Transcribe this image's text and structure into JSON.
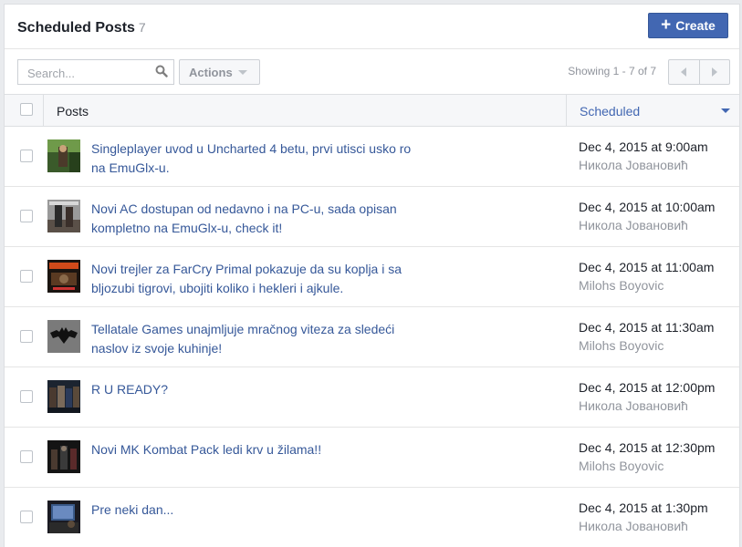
{
  "header": {
    "title": "Scheduled Posts",
    "count": "7",
    "create_label": "Create"
  },
  "toolbar": {
    "search_placeholder": "Search...",
    "actions_label": "Actions",
    "showing_text": "Showing 1 - 7 of 7"
  },
  "table": {
    "col_posts": "Posts",
    "col_scheduled": "Scheduled",
    "rows": [
      {
        "text": "Singleplayer uvod u Uncharted 4 betu, prvi utisci usko ro na EmuGlx-u.",
        "time": "Dec 4, 2015 at 9:00am",
        "author": "Никола Јовановић"
      },
      {
        "text": "Novi AC dostupan od nedavno i na PC-u, sada opisan kompletno na EmuGlx-u, check it!",
        "time": "Dec 4, 2015 at 10:00am",
        "author": "Никола Јовановић"
      },
      {
        "text": "Novi trejler za FarCry Primal pokazuje da su koplja i sa bljozubi tigrovi, ubojiti koliko i hekleri i ajkule.",
        "time": "Dec 4, 2015 at 11:00am",
        "author": "Milohs Boyovic"
      },
      {
        "text": "Tellatale Games unajmljuje mračnog viteza za sledeći naslov iz svoje kuhinje!",
        "time": "Dec 4, 2015 at 11:30am",
        "author": "Milohs Boyovic"
      },
      {
        "text": "R U READY?",
        "time": "Dec 4, 2015 at 12:00pm",
        "author": "Никола Јовановић"
      },
      {
        "text": "Novi MK Kombat Pack ledi krv u žilama!!",
        "time": "Dec 4, 2015 at 12:30pm",
        "author": "Milohs Boyovic"
      },
      {
        "text": "Pre neki dan...",
        "time": "Dec 4, 2015 at 1:30pm",
        "author": "Никола Јовановић"
      }
    ]
  },
  "colors": {
    "brand": "#4267b2",
    "link": "#365899",
    "muted": "#90949c"
  }
}
